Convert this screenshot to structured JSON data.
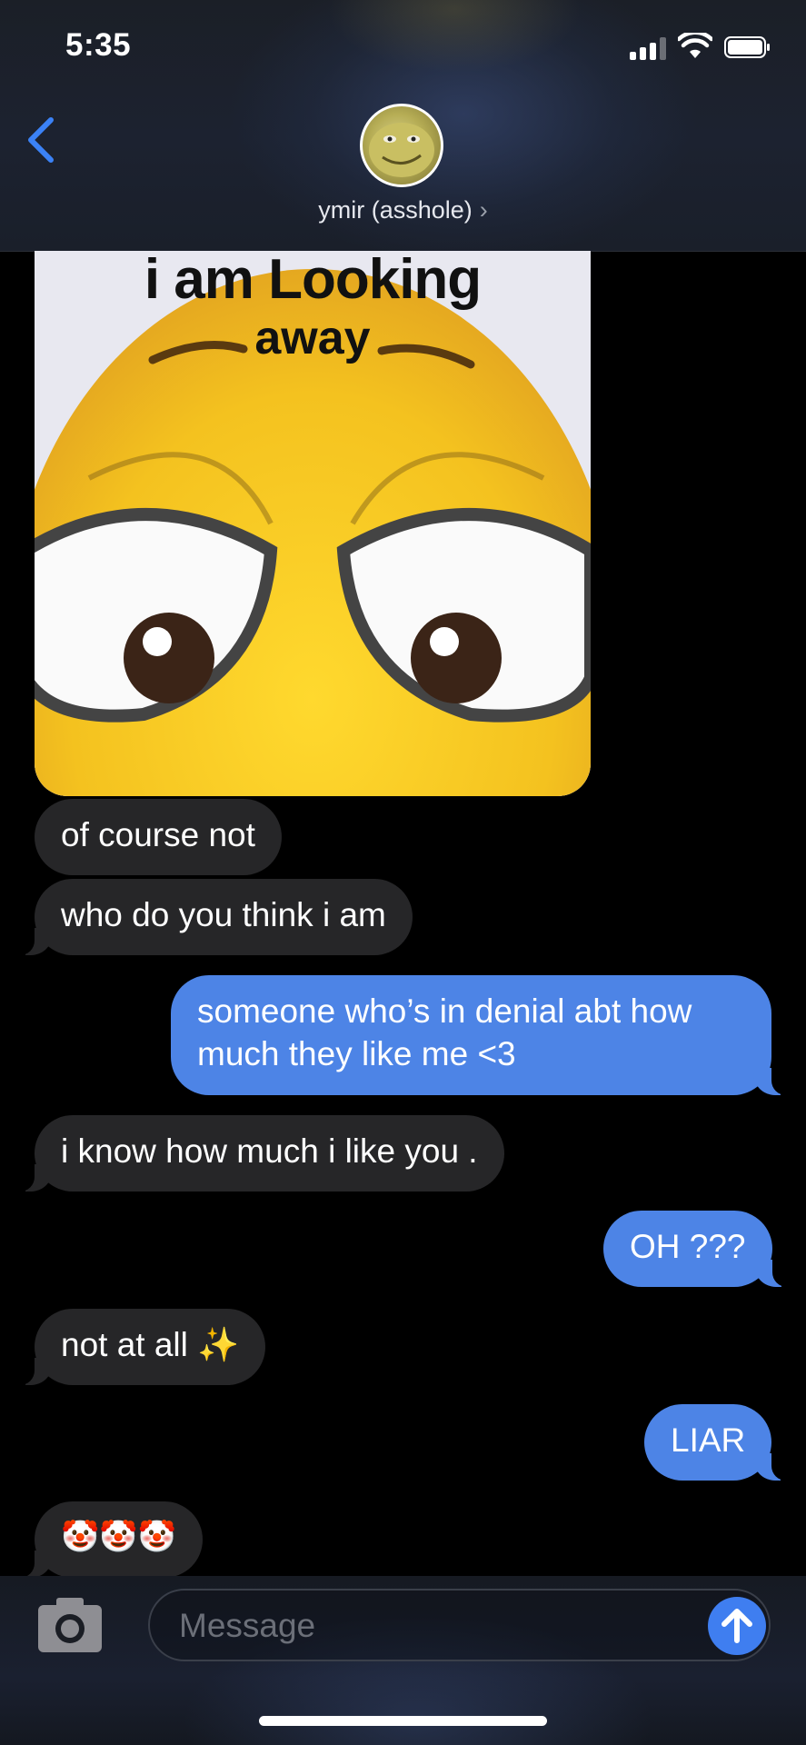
{
  "status_bar": {
    "time": "5:35"
  },
  "header": {
    "contact_name": "ymir (asshole)",
    "chevron": "›"
  },
  "image_message": {
    "caption_line1": "i am Looking",
    "caption_line2": "away"
  },
  "messages": [
    {
      "direction": "received",
      "text": "of course not"
    },
    {
      "direction": "received",
      "text": "who do you think i am"
    },
    {
      "direction": "sent",
      "lines": [
        "someone who’s in denial abt how",
        "much they like me <3"
      ]
    },
    {
      "direction": "received",
      "text": "i know how much i like you ."
    },
    {
      "direction": "sent",
      "text": "OH ???"
    },
    {
      "direction": "received",
      "text": "not at all ✨"
    },
    {
      "direction": "sent",
      "text": "LIAR"
    },
    {
      "direction": "received",
      "text": "🤡🤡🤡"
    }
  ],
  "input_bar": {
    "placeholder": "Message"
  },
  "colors": {
    "sent_bubble": "#4d84e6",
    "received_bubble": "#262628",
    "accent": "#3f7ef0"
  },
  "icons": [
    "back-chevron-icon",
    "cellular-signal-icon",
    "wifi-icon",
    "battery-icon",
    "camera-icon",
    "send-arrow-icon",
    "contact-avatar"
  ]
}
